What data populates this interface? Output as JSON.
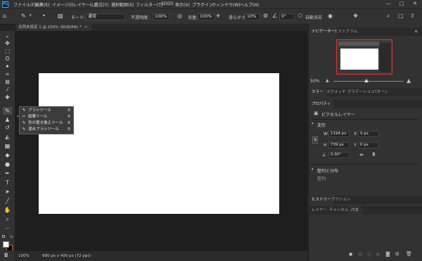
{
  "app": {
    "logo_text": "Ps"
  },
  "menubar": {
    "items": [
      "ファイル(F)",
      "編集(E)",
      "イメージ(I)",
      "レイヤー(L)",
      "書式(Y)",
      "選択範囲(S)",
      "フィルター(T)",
      "3D(D)",
      "表示(V)",
      "プラグイン",
      "ウィンドウ(W)",
      "ヘルプ(H)"
    ],
    "window_controls": [
      "—",
      "□",
      "✕"
    ]
  },
  "options": {
    "mode_label": "モード:",
    "mode_value": "通常",
    "opacity_label": "不透明度:",
    "opacity_value": "100%",
    "flow_label": "流量:",
    "flow_value": "100%",
    "smoothing_label": "滑らかさ:",
    "smoothing_value": "10%",
    "angle_value": "0°",
    "auto_erase_label": "自動消去"
  },
  "document": {
    "tab_title": "名称未設定 1 @ 100% (RGB/8#) *"
  },
  "flyout": {
    "items": [
      {
        "label": "ブラシツール",
        "key": "B"
      },
      {
        "label": "鉛筆ツール",
        "key": "B"
      },
      {
        "label": "色の置き換えツール",
        "key": "B"
      },
      {
        "label": "混合ブラシツール",
        "key": "B"
      }
    ]
  },
  "status": {
    "zoom": "100%",
    "doc_info": "680 px x 400 px (72 ppi)"
  },
  "navigator": {
    "tabs": [
      "ナビゲーター",
      "ヒストグラム"
    ],
    "zoom": "50%"
  },
  "color_panel": {
    "tabs": [
      "カラー",
      "スウォッチ",
      "グラデーション",
      "パターン"
    ]
  },
  "properties": {
    "tab": "プロパティ",
    "layer_type": "ピクセルレイヤー",
    "transform_header": "変形",
    "w_label": "W",
    "w_value": "1194 px",
    "x_label": "X",
    "x_value": "0 px",
    "h_label": "H",
    "h_value": "739 px",
    "y_label": "Y",
    "y_value": "0 px",
    "angle_value": "0.00°",
    "align_header": "整列と分布",
    "align_label": "整列:"
  },
  "history_panel": {
    "tabs": [
      "ヒストリー",
      "アクション"
    ]
  },
  "layers_panel": {
    "tabs": [
      "レイヤー",
      "チャンネル",
      "パス"
    ]
  },
  "colors": {
    "accent": "#31a8ff",
    "nav_highlight": "#e03434",
    "canvas": "#ffffff"
  }
}
